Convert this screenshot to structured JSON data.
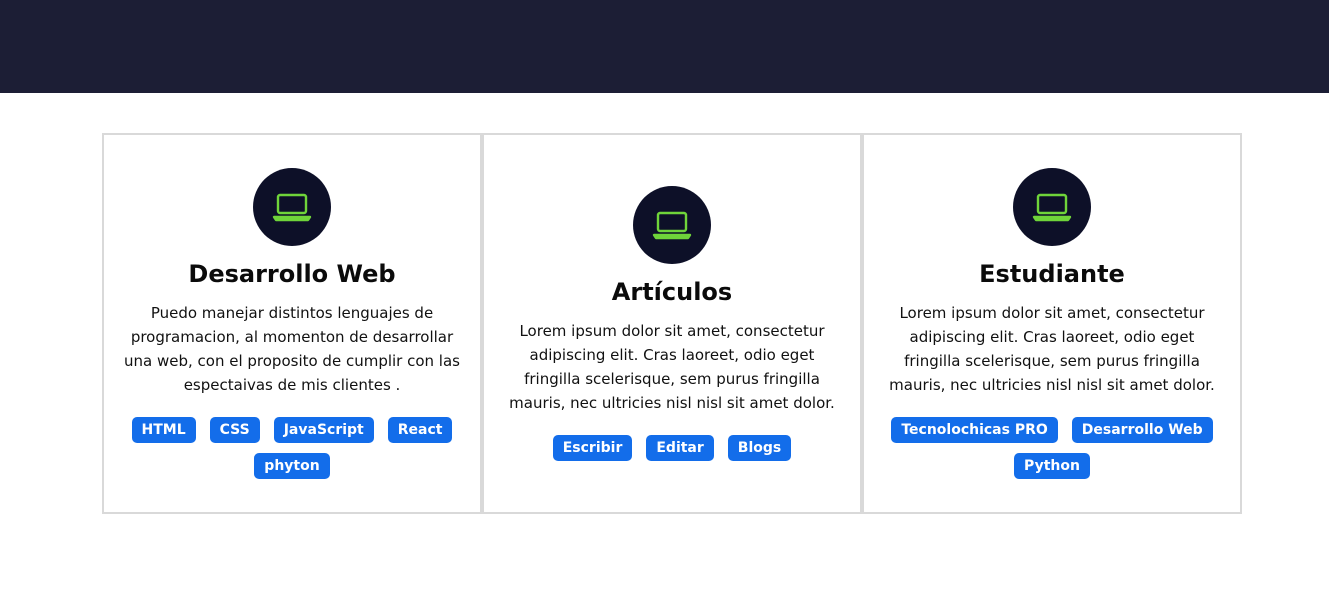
{
  "colors": {
    "topbar": "#1c1e35",
    "icon_circle": "#0d1028",
    "icon_stroke": "#6fd43a",
    "tag_bg": "#136dea",
    "card_border": "#d9d9d9"
  },
  "cards": [
    {
      "icon": "laptop-icon",
      "title": "Desarrollo Web",
      "description": "Puedo manejar distintos lenguajes de programacion, al momenton de desarrollar una web, con el proposito de cumplir con las espectaivas de mis clientes .",
      "tags": [
        "HTML",
        "CSS",
        "JavaScript",
        "React",
        "phyton"
      ]
    },
    {
      "icon": "laptop-icon",
      "title": "Artículos",
      "description": "Lorem ipsum dolor sit amet, consectetur adipiscing elit. Cras laoreet, odio eget fringilla scelerisque, sem purus fringilla mauris, nec ultricies nisl nisl sit amet dolor.",
      "tags": [
        "Escribir",
        "Editar",
        "Blogs"
      ]
    },
    {
      "icon": "laptop-icon",
      "title": "Estudiante",
      "description": "Lorem ipsum dolor sit amet, consectetur adipiscing elit. Cras laoreet, odio eget fringilla scelerisque, sem purus fringilla mauris, nec ultricies nisl nisl sit amet dolor.",
      "tags": [
        "Tecnolochicas PRO",
        "Desarrollo Web",
        "Python"
      ]
    }
  ]
}
